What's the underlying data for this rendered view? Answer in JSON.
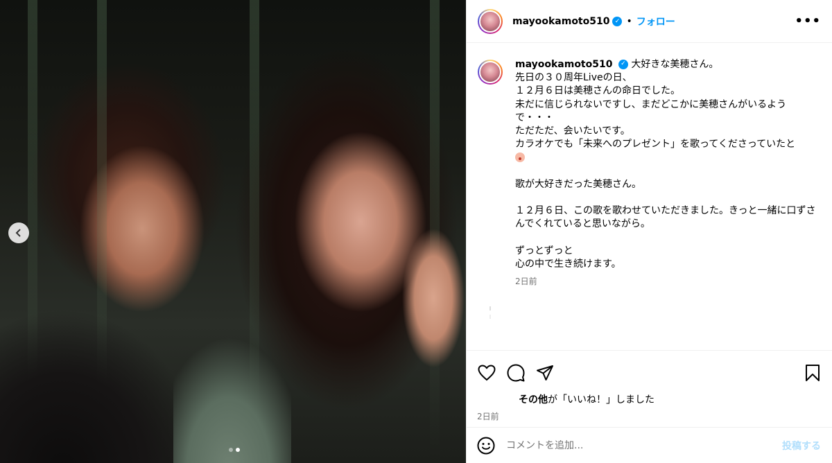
{
  "header": {
    "username": "mayookamoto510",
    "separator": "•",
    "follow_label": "フォロー",
    "more_label": "•••"
  },
  "caption": {
    "username": "mayookamoto510",
    "lines": [
      "大好きな美穂さん。",
      "先日の３０周年Liveの日、",
      "１２月６日は美穂さんの命日でした。",
      "未だに信じられないですし、まだどこかに美穂さんがいるようで・・・",
      "ただただ、会いたいです。",
      "カラオケでも「未来へのプレゼント」を歌ってくださっていたと",
      "",
      "歌が大好きだった美穂さん。",
      "",
      "１２月６日、この歌を歌わせていただきました。きっと一緒に口ずさんでくれていると思いながら。",
      "",
      "ずっとずっと",
      "心の中で生き続けます。"
    ],
    "time": "2日前"
  },
  "likes": {
    "bold_part": "その他",
    "rest": "が「いいね！」しました"
  },
  "post_time": "2日前",
  "comment": {
    "placeholder": "コメントを追加...",
    "post_label": "投稿する"
  },
  "icons": {
    "carousel_prev": "chevron-left-icon",
    "like": "heart-icon",
    "comment": "comment-icon",
    "share": "send-icon",
    "save": "bookmark-icon",
    "emoji": "smiley-icon"
  },
  "colors": {
    "accent": "#0095f6",
    "post_disabled": "#b2dffc",
    "muted": "#737373"
  },
  "carousel": {
    "current": 2,
    "total": 2
  }
}
